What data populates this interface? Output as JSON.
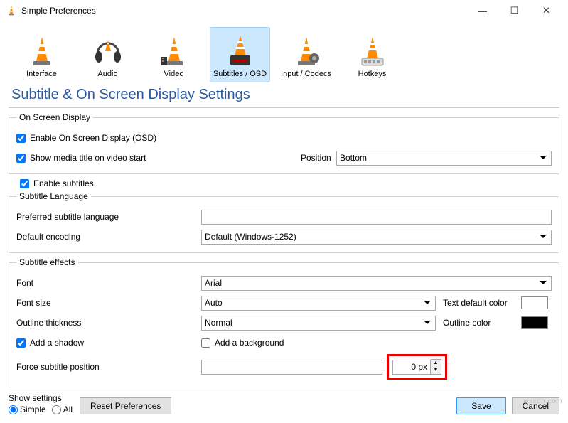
{
  "window": {
    "title": "Simple Preferences",
    "minimize": "—",
    "maximize": "☐",
    "close": "✕"
  },
  "categories": [
    {
      "key": "interface",
      "label": "Interface"
    },
    {
      "key": "audio",
      "label": "Audio"
    },
    {
      "key": "video",
      "label": "Video"
    },
    {
      "key": "subtitles",
      "label": "Subtitles / OSD"
    },
    {
      "key": "codecs",
      "label": "Input / Codecs"
    },
    {
      "key": "hotkeys",
      "label": "Hotkeys"
    }
  ],
  "heading": "Subtitle & On Screen Display Settings",
  "osd": {
    "legend": "On Screen Display",
    "enable_osd": "Enable On Screen Display (OSD)",
    "show_title": "Show media title on video start",
    "position_label": "Position",
    "position_value": "Bottom"
  },
  "enable_subtitles": "Enable subtitles",
  "lang": {
    "legend": "Subtitle Language",
    "pref_label": "Preferred subtitle language",
    "pref_value": "",
    "enc_label": "Default encoding",
    "enc_value": "Default (Windows-1252)"
  },
  "effects": {
    "legend": "Subtitle effects",
    "font_label": "Font",
    "font_value": "Arial",
    "size_label": "Font size",
    "size_value": "Auto",
    "text_color_label": "Text default color",
    "text_color": "#ffffff",
    "outline_label": "Outline thickness",
    "outline_value": "Normal",
    "outline_color_label": "Outline color",
    "outline_color": "#000000",
    "shadow_label": "Add a shadow",
    "background_label": "Add a background",
    "force_label": "Force subtitle position",
    "force_value": "0 px"
  },
  "bottom": {
    "show_settings": "Show settings",
    "simple": "Simple",
    "all": "All",
    "reset": "Reset Preferences",
    "save": "Save",
    "cancel": "Cancel"
  },
  "watermark": "wsxdn.com"
}
